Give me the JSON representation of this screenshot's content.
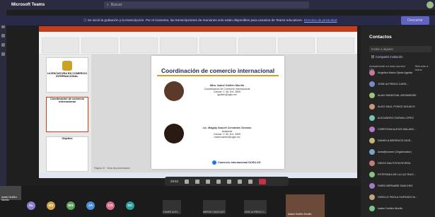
{
  "app": {
    "name": "Microsoft Teams",
    "search_placeholder": "Buscar"
  },
  "banner": {
    "message": "Se inició la grabación y la transcripción. Por el momento, las transcripciones de reuniones solo están disponibles para usuarios de Teams educativos.",
    "link": "Directiva de privacidad",
    "leave_label": "Descartar"
  },
  "slide": {
    "title": "Coordinación de comercio internacional",
    "person1": {
      "name": "Mtra. Isabel Guillén Murillo",
      "role": "Coordinadora de Comercio Internacional",
      "phone": "Celular: C 48, Ext. 2805",
      "email": "iguillen@ugto.mx"
    },
    "person2": {
      "name": "Lic. Magaly Araceli Cervantes Serrano",
      "role": "Asistente",
      "phone": "Celular: C 50, Ext. 2805",
      "email": "macervantes@ugto.mx"
    },
    "facebook": "Comercio Internacional DCEA UG",
    "status": "Página 10 · Vista de presentación"
  },
  "thumbs": [
    {
      "title": "LICENCIATURA EN COMERCIO INTERNACIONAL"
    },
    {
      "title": "Coordinación de comercio internacional"
    },
    {
      "title": "Objetivo"
    }
  ],
  "controls": {
    "time": "28:53"
  },
  "bottom": {
    "presenter": "Isabel Guillén Murillo",
    "participants": [
      {
        "initials": "AL",
        "color": "#8a7fd4"
      },
      {
        "initials": "NS",
        "color": "#cfa64b"
      },
      {
        "initials": "MS",
        "color": "#5fa35f"
      },
      {
        "initials": "JA",
        "color": "#4a8fd8"
      },
      {
        "initials": "CG",
        "color": "#d8708a"
      },
      {
        "initials": "DC",
        "color": "#2e9c9c"
      }
    ],
    "tiles": [
      "CONSE ALEX...",
      "MERGE DIAZ/CAST",
      "JOSE ALFREDO C..."
    ],
    "self": "Isabel Guillén Murillo"
  },
  "panel": {
    "title": "Contactos",
    "invite_placeholder": "Invitar a alguien",
    "share_label": "Compartir invitación",
    "section": "Actualmente en esta reunión (35)",
    "mute_all": "Silenciar a todos",
    "contacts": [
      {
        "name": "Angélica María Ojeda Aguilar",
        "color": "#c47a9a"
      },
      {
        "name": "JOSE ALFREDO CARD...",
        "color": "#7a8ac4"
      },
      {
        "name": "ALAN SANDOVAL ARZAMENDI",
        "color": "#9ac47a"
      },
      {
        "name": "ALDO SAUL PONCE AGUAYO",
        "color": "#c49a7a"
      },
      {
        "name": "ALEJANDRO DURAN LOPEZ",
        "color": "#7ac4b4"
      },
      {
        "name": "CHRISTIAN ALEXIS MALANC...",
        "color": "#b47ac4"
      },
      {
        "name": "DANIELA BERENICE MOS...",
        "color": "#c4b47a"
      },
      {
        "name": "dcea@ucsme (Organizador)",
        "color": "#7aa4c4"
      },
      {
        "name": "DIEGO BAUTISTA RIVERA",
        "color": "#c47a7a"
      },
      {
        "name": "ESTEFANIA DE LA LUZ RUIZ...",
        "color": "#8ac47a"
      },
      {
        "name": "FARID BERNABE SANCHEZ",
        "color": "#a47ac4"
      },
      {
        "name": "GISELLE PAOLA HURTADO M...",
        "color": "#c4a47a"
      },
      {
        "name": "Isabel Guillén Murillo",
        "color": "#7ac48a"
      }
    ]
  },
  "colors": {
    "teams_purple": "#5f64c4",
    "accent_ppt": "#c43e1c",
    "end_call": "#c4314b"
  }
}
